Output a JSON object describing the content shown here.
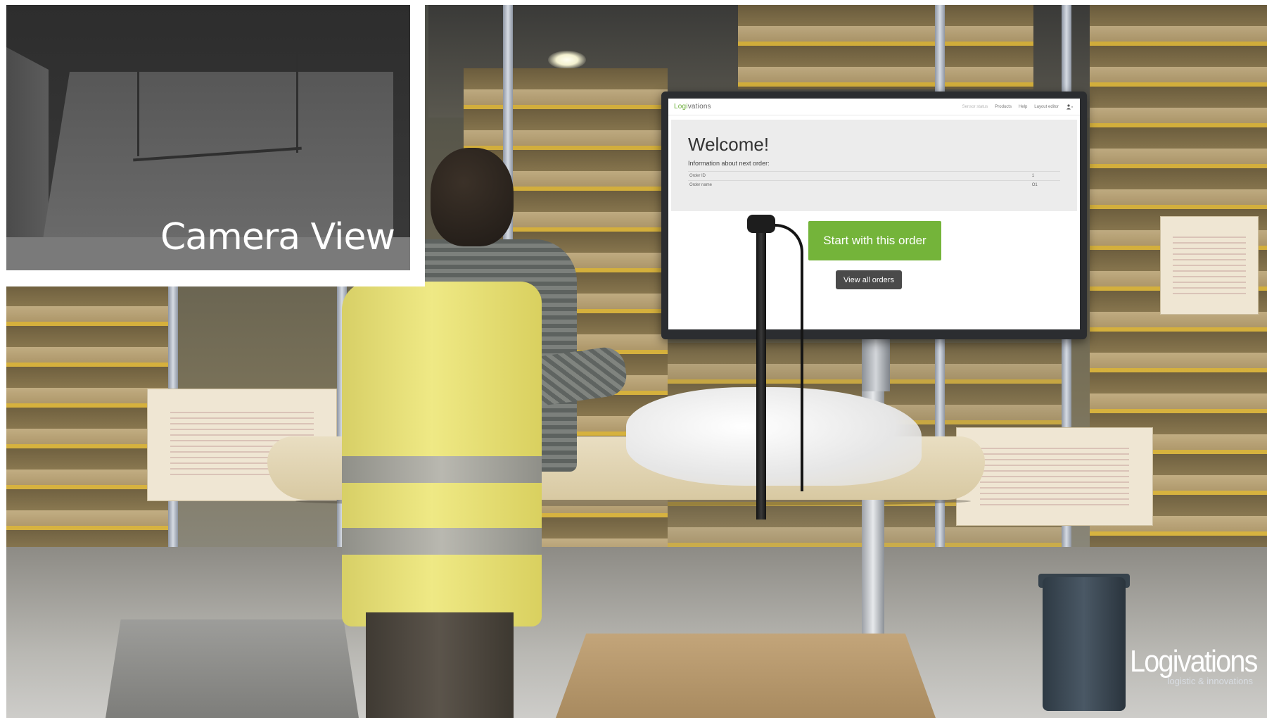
{
  "camera_view": {
    "label": "Camera View"
  },
  "monitor_app": {
    "logo": {
      "prefix": "Logi",
      "suffix": "vations"
    },
    "nav": {
      "status": "Sensor status",
      "products": "Products",
      "help": "Help",
      "layout_editor": "Layout editor",
      "user_menu_icon": "user-icon"
    },
    "welcome": {
      "heading": "Welcome!",
      "info": "Information about next order:"
    },
    "order_table": [
      {
        "label": "Order ID",
        "value": "1"
      },
      {
        "label": "Order name",
        "value": "O1"
      }
    ],
    "buttons": {
      "start": "Start with this order",
      "view_all": "View all orders"
    },
    "colors": {
      "accent_green": "#74b43a",
      "dark_button": "#4a4a4a"
    }
  },
  "brand": {
    "name": "Logivations",
    "tagline": "logistic & innovations"
  }
}
